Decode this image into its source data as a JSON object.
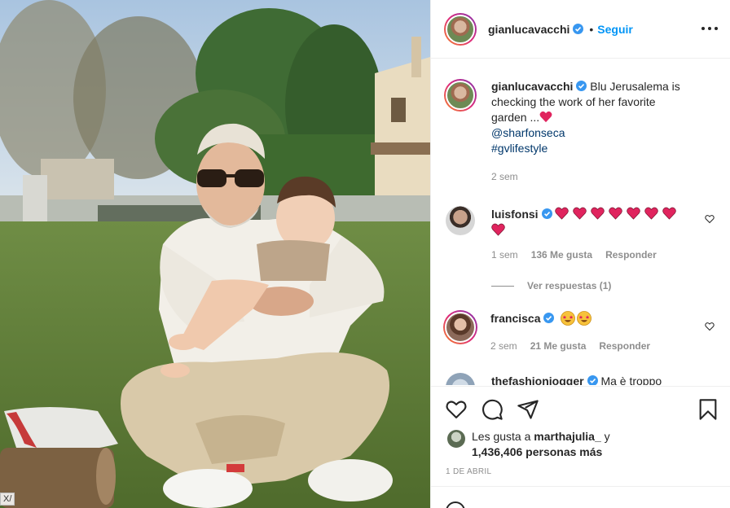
{
  "post": {
    "username": "gianlucavacchi",
    "follow_label": "Seguir",
    "dot": "•",
    "caption": {
      "username": "gianlucavacchi",
      "text": "Blu Jerusalema is checking the work of her favorite garden ...",
      "mention": "@sharfonseca",
      "hashtag": "#gvlifestyle",
      "age": "2 sem"
    },
    "comments": [
      {
        "username": "luisfonsi",
        "hearts": 8,
        "age": "1 sem",
        "likes": "136 Me gusta",
        "reply_label": "Responder",
        "view_replies": "Ver respuestas (1)"
      },
      {
        "username": "francisca",
        "emoji_count": 2,
        "age": "2 sem",
        "likes": "21 Me gusta",
        "reply_label": "Responder"
      },
      {
        "username": "thefashionjogger",
        "text": "Ma è troppo"
      }
    ],
    "likes": {
      "prefix": "Les gusta a",
      "user": "marthajulia_",
      "suffix": "y",
      "count": "1,436,406 personas más"
    },
    "date": "1 DE ABRIL",
    "corner_tag": "X/"
  },
  "icons": {
    "more": "more-options-icon",
    "like": "heart-icon",
    "comment": "comment-icon",
    "share": "share-icon",
    "save": "bookmark-icon",
    "verified": "verified-badge-icon"
  },
  "colors": {
    "link": "#0095f6",
    "heart": "#ed4956",
    "mention": "#00376b",
    "muted": "#8e8e8e",
    "verified": "#3897f0"
  }
}
